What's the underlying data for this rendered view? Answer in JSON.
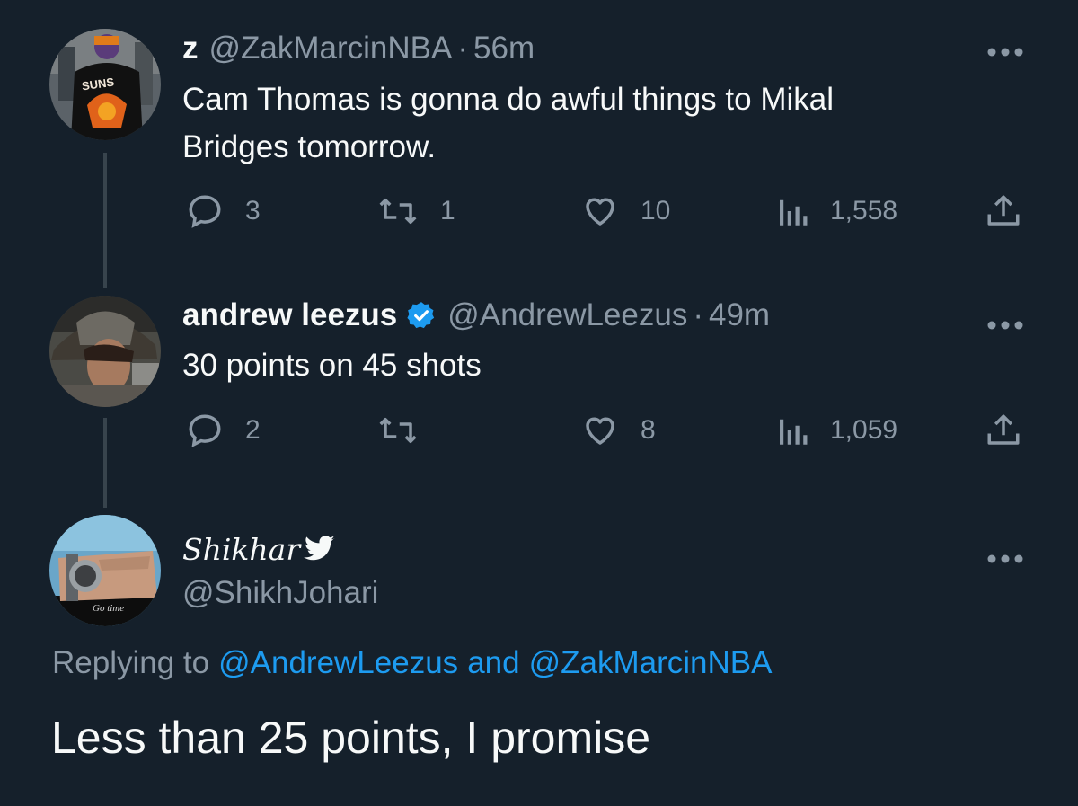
{
  "tweets": [
    {
      "name": "z",
      "handle": "@ZakMarcinNBA",
      "sep": "·",
      "time": "56m",
      "text_line1": "Cam Thomas is gonna do awful things to Mikal",
      "text_line2": "Bridges tomorrow.",
      "replies": "3",
      "retweets": "1",
      "likes": "10",
      "views": "1,558",
      "avatar_text": "SUNS"
    },
    {
      "name": "andrew leezus",
      "handle": "@AndrewLeezus",
      "sep": "·",
      "time": "49m",
      "text": "30 points on 45 shots",
      "replies": "2",
      "retweets": "",
      "likes": "8",
      "views": "1,059"
    }
  ],
  "main_tweet": {
    "name": "Shikhar",
    "handle": "@ShikhJohari",
    "replying_prefix": "Replying to",
    "mention1": "@AndrewLeezus",
    "replying_and": "and",
    "mention2": "@ZakMarcinNBA",
    "text": "Less than 25 points, I promise",
    "avatar_text": "Go time"
  },
  "colors": {
    "background": "#15202b",
    "text": "#f7f9f9",
    "muted": "#8b98a5",
    "accent": "#1d9bf0"
  },
  "icons": [
    "more-icon",
    "reply-icon",
    "retweet-icon",
    "like-icon",
    "views-icon",
    "share-icon",
    "verified-badge-icon",
    "twitter-bird-icon"
  ]
}
